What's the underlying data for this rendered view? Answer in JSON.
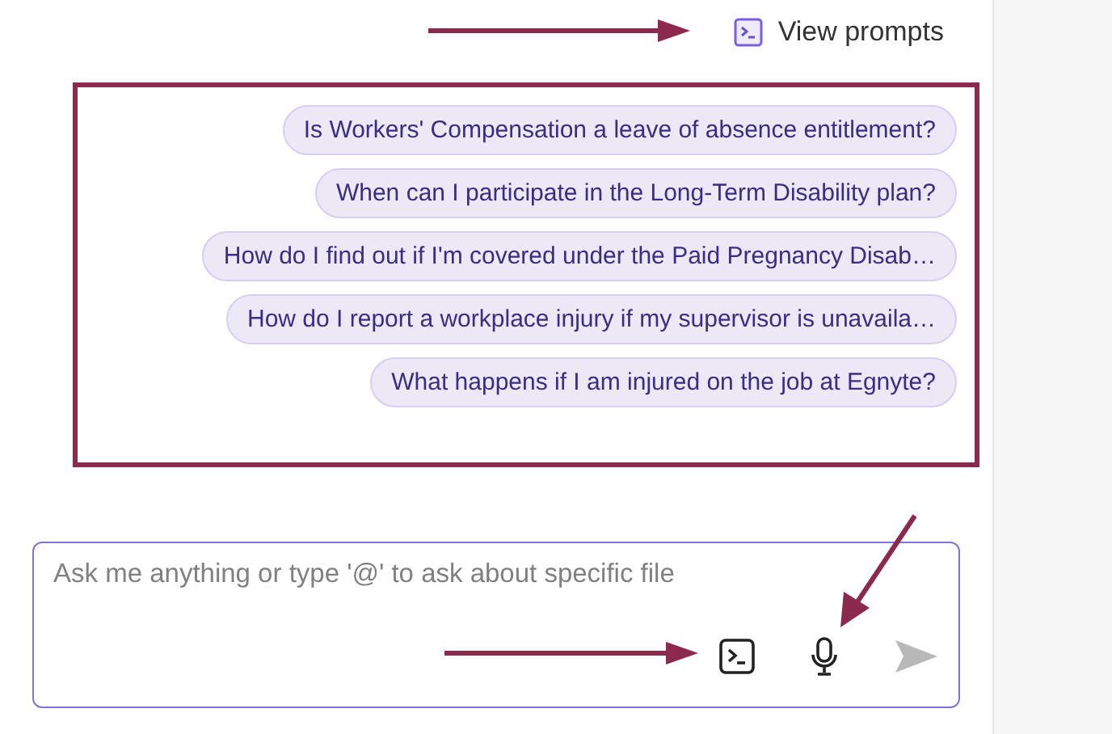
{
  "view_prompts": {
    "label": "View prompts"
  },
  "prompts": [
    {
      "text": "Is Workers' Compensation a leave of absence entitlement?"
    },
    {
      "text": "When can I participate in the Long-Term Disability plan?"
    },
    {
      "text": "How do I find out if I'm covered under the Paid Pregnancy Disab…"
    },
    {
      "text": "How do I report a workplace injury if my supervisor is unavaila…"
    },
    {
      "text": "What happens if I am injured on the job at Egnyte?"
    }
  ],
  "input": {
    "placeholder": "Ask me anything or type '@' to ask about specific file"
  },
  "send_button": {
    "disabled": true
  }
}
